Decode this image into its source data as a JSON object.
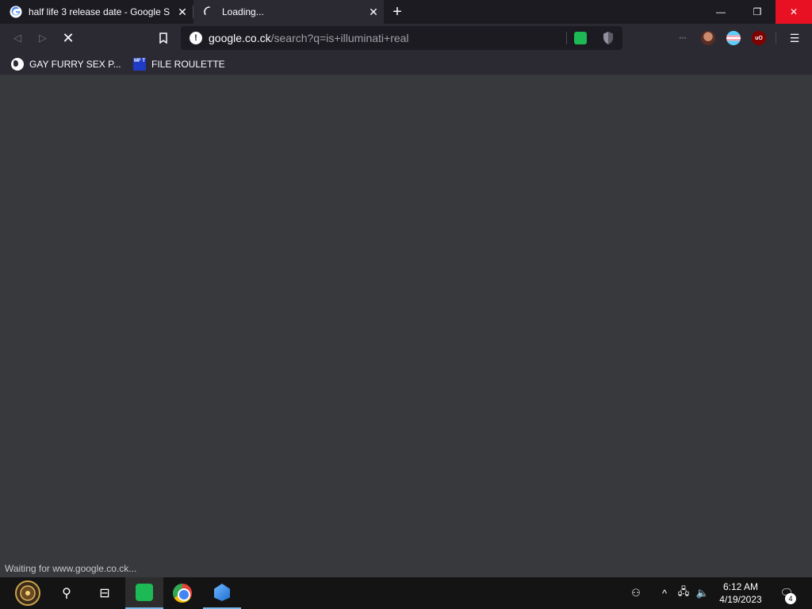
{
  "tabs": [
    {
      "title": "half life 3 release date - Google S",
      "favicon": "google-g-icon",
      "close": "✕"
    },
    {
      "title": "Loading...",
      "favicon": "loading-spinner-icon",
      "close": "✕"
    }
  ],
  "new_tab": "+",
  "window_controls": {
    "minimize": "—",
    "maximize": "❐",
    "close": "✕"
  },
  "nav": {
    "back": "◁",
    "forward": "▷",
    "stop": "✕",
    "bookmark": "🔖",
    "menu": "☰"
  },
  "url": {
    "info": "!",
    "domain": "google.co.ck",
    "path": "/search?q=is+illuminati+real"
  },
  "extensions": [
    "dots-icon",
    "avatar-icon",
    "trans-flag-icon",
    "ublock-icon"
  ],
  "ublock_label": "uO",
  "bookmarks": [
    {
      "label": "GAY FURRY SEX P...",
      "icon": "globe-icon"
    },
    {
      "label": "FILE ROULETTE",
      "icon": "mft-icon",
      "icon_text": "MF T"
    }
  ],
  "status_text": "Waiting for www.google.co.ck...",
  "taskbar": {
    "search": "⚲",
    "taskview": "⊟",
    "people": "⚇",
    "chevron": "^",
    "network": "🖧",
    "volume": "🔈",
    "time": "6:12 AM",
    "date": "4/19/2023",
    "notifications": "🗨",
    "notification_count": "4"
  },
  "colors": {
    "tab_strip": "#1c1b22",
    "toolbar": "#2b2a33",
    "content": "#38393d",
    "close_red": "#e81123",
    "taskbar": "#141414"
  }
}
